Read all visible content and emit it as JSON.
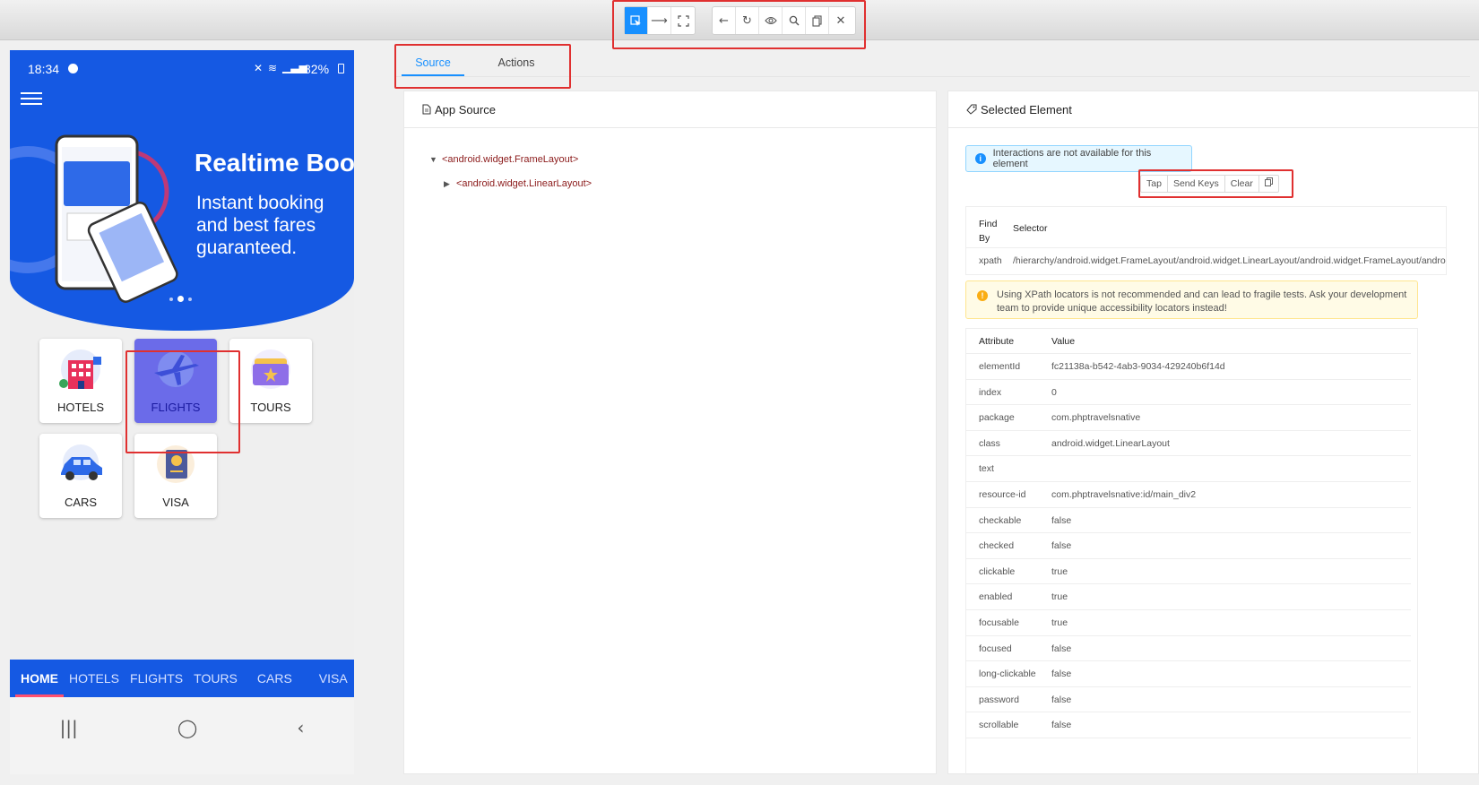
{
  "toolbar": {
    "left_icons": [
      "select-element-icon",
      "swipe-icon",
      "tap-by-coordinates-icon"
    ],
    "right_icons": [
      "back-icon",
      "refresh-icon",
      "eye-icon",
      "search-icon",
      "copy-icon",
      "close-icon"
    ]
  },
  "phone": {
    "status": {
      "time": "18:34",
      "battery": "82%"
    },
    "hero": {
      "title": "Realtime Boo",
      "subtitle": "Instant booking and best fares guaranteed."
    },
    "categories": [
      {
        "label": "HOTELS",
        "icon": "hotel-icon"
      },
      {
        "label": "FLIGHTS",
        "icon": "airplane-icon"
      },
      {
        "label": "TOURS",
        "icon": "ticket-icon"
      },
      {
        "label": "CARS",
        "icon": "car-icon"
      },
      {
        "label": "VISA",
        "icon": "passport-icon"
      }
    ],
    "bottom_nav": [
      "HOME",
      "HOTELS",
      "FLIGHTS",
      "TOURS",
      "CARS",
      "VISA"
    ],
    "system_nav": {
      "recents": "|||",
      "home": "◯",
      "back": "‹"
    }
  },
  "tabs": {
    "source": "Source",
    "actions": "Actions"
  },
  "app_source": {
    "title": "App Source",
    "nodes": [
      "<android.widget.FrameLayout>",
      "<android.widget.LinearLayout>"
    ]
  },
  "selected_element": {
    "title": "Selected Element",
    "info": "Interactions are not available for this element",
    "actions": [
      "Tap",
      "Send Keys",
      "Clear"
    ],
    "selector_table": {
      "find_by_header": "Find By",
      "selector_header": "Selector",
      "row": {
        "find_by": "xpath",
        "selector": "/hierarchy/android.widget.FrameLayout/android.widget.LinearLayout/android.widget.FrameLayout/android.wi"
      }
    },
    "warning": "Using XPath locators is not recommended and can lead to fragile tests. Ask your development team to provide unique accessibility locators instead!",
    "attr_header": {
      "attribute": "Attribute",
      "value": "Value"
    },
    "attributes": [
      {
        "k": "elementId",
        "v": "fc21138a-b542-4ab3-9034-429240b6f14d"
      },
      {
        "k": "index",
        "v": "0"
      },
      {
        "k": "package",
        "v": "com.phptravelsnative"
      },
      {
        "k": "class",
        "v": "android.widget.LinearLayout"
      },
      {
        "k": "text",
        "v": ""
      },
      {
        "k": "resource-id",
        "v": "com.phptravelsnative:id/main_div2"
      },
      {
        "k": "checkable",
        "v": "false"
      },
      {
        "k": "checked",
        "v": "false"
      },
      {
        "k": "clickable",
        "v": "true"
      },
      {
        "k": "enabled",
        "v": "true"
      },
      {
        "k": "focusable",
        "v": "true"
      },
      {
        "k": "focused",
        "v": "false"
      },
      {
        "k": "long-clickable",
        "v": "false"
      },
      {
        "k": "password",
        "v": "false"
      },
      {
        "k": "scrollable",
        "v": "false"
      }
    ]
  }
}
